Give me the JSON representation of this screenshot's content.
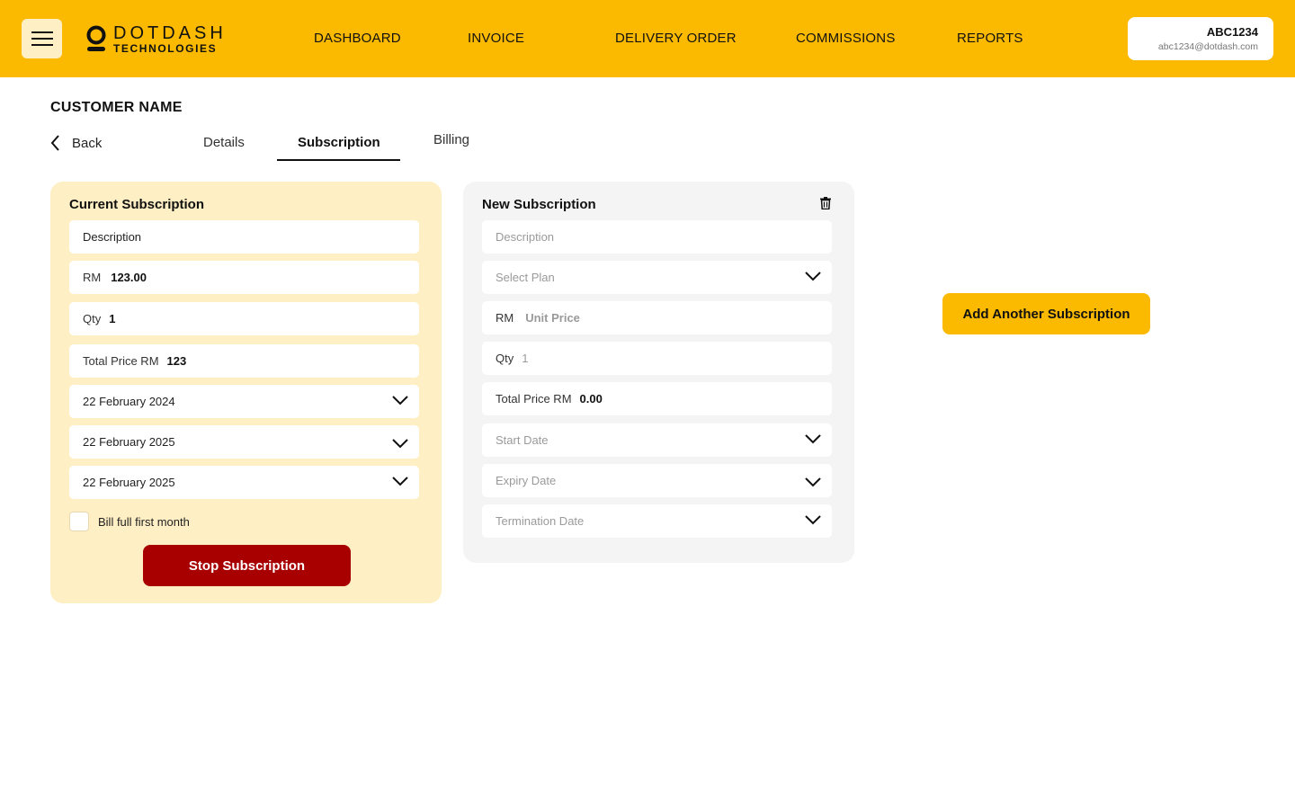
{
  "header": {
    "logo": {
      "line1": "DOTDASH",
      "line2": "TECHNOLOGIES"
    },
    "nav": [
      "DASHBOARD",
      "INVOICE",
      "DELIVERY ORDER",
      "COMMISSIONS",
      "REPORTS"
    ],
    "user": {
      "id": "ABC1234",
      "email": "abc1234@dotdash.com"
    }
  },
  "page": {
    "customer_name": "CUSTOMER NAME",
    "back_label": "Back",
    "tabs": [
      "Details",
      "Subscription",
      "Billing"
    ],
    "active_tab": "Subscription"
  },
  "current_subscription": {
    "title": "Current Subscription",
    "description": "Description",
    "price_prefix": "RM",
    "price": "123.00",
    "qty_label": "Qty",
    "qty": "1",
    "total_label": "Total Price RM",
    "total": "123",
    "start_date": "22 February 2024",
    "expiry_date": "22 February 2025",
    "termination_date": "22 February 2025",
    "bill_full_first_month_label": "Bill full first month",
    "bill_full_first_month": false,
    "stop_button": "Stop Subscription"
  },
  "new_subscription": {
    "title": "New Subscription",
    "description_placeholder": "Description",
    "plan_placeholder": "Select Plan",
    "price_prefix": "RM",
    "price_placeholder": "Unit Price",
    "qty_label": "Qty",
    "qty_placeholder": "1",
    "total_label": "Total Price RM",
    "total": "0.00",
    "start_date_placeholder": "Start Date",
    "expiry_date_placeholder": "Expiry Date",
    "termination_date_placeholder": "Termination Date"
  },
  "add_button": "Add Another Subscription",
  "colors": {
    "brand": "#FBB900",
    "current_panel": "#FFEFC4",
    "new_panel": "#F4F4F4",
    "danger": "#A80000"
  }
}
